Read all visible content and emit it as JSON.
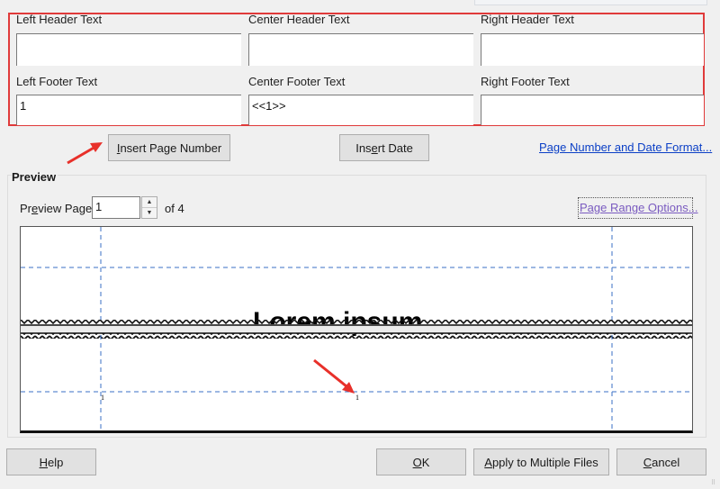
{
  "header_footer": {
    "left_header_label": "Left Header Text",
    "center_header_label": "Center Header Text",
    "right_header_label": "Right Header Text",
    "left_header_value": "",
    "center_header_value": "",
    "right_header_value": "",
    "left_footer_label": "Left Footer Text",
    "center_footer_label": "Center Footer Text",
    "right_footer_label": "Right Footer Text",
    "left_footer_value": "1",
    "center_footer_value": "<<1>>",
    "right_footer_value": ""
  },
  "actions": {
    "insert_page_number_pre": "I",
    "insert_page_number_post": "nsert Page Number",
    "insert_date_pre": "Ins",
    "insert_date_u": "e",
    "insert_date_post": "rt Date",
    "format_link_pre": "Page N",
    "format_link_u": "u",
    "format_link_post": "mber and Date Format..."
  },
  "preview": {
    "title": "Preview",
    "page_label_pre": "Pr",
    "page_label_u": "e",
    "page_label_post": "view Page",
    "page_value": "1",
    "of_label": "of 4",
    "range_link_pre": "Page Ran",
    "range_link_u": "g",
    "range_link_post": "e Options...",
    "sample_text": "Lorem ipsum",
    "footer_left_value": "1",
    "footer_center_value": "1",
    "guide_color": "#3a6fc4"
  },
  "buttons": {
    "help_u": "H",
    "help_post": "elp",
    "ok_u": "O",
    "ok_post": "K",
    "apply_u": "A",
    "apply_post": "pply to Multiple Files",
    "cancel_u": "C",
    "cancel_post": "ancel"
  },
  "annotations": {
    "frame_color": "#e03a3a",
    "arrow_color": "#e8302a"
  }
}
